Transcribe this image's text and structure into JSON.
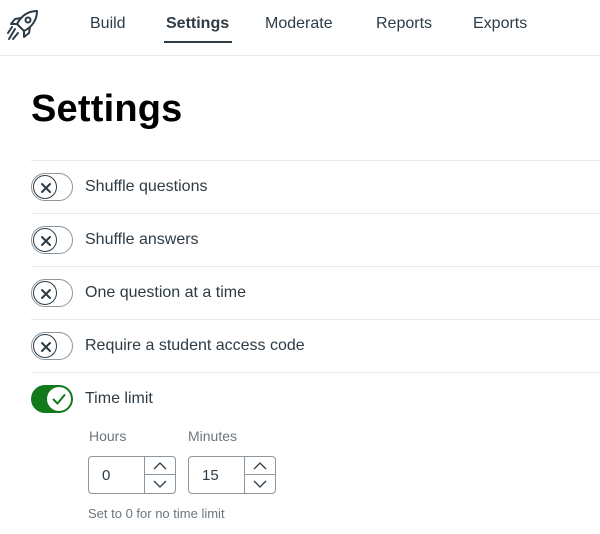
{
  "nav": {
    "logo_icon": "rocket-icon",
    "tabs": [
      {
        "label": "Build",
        "active": false
      },
      {
        "label": "Settings",
        "active": true
      },
      {
        "label": "Moderate",
        "active": false
      },
      {
        "label": "Reports",
        "active": false
      },
      {
        "label": "Exports",
        "active": false
      }
    ]
  },
  "page_title": "Settings",
  "settings": [
    {
      "label": "Shuffle questions",
      "enabled": false
    },
    {
      "label": "Shuffle answers",
      "enabled": false
    },
    {
      "label": "One question at a time",
      "enabled": false
    },
    {
      "label": "Require a student access code",
      "enabled": false
    },
    {
      "label": "Time limit",
      "enabled": true
    }
  ],
  "time_limit": {
    "hours_label": "Hours",
    "hours_value": "0",
    "minutes_label": "Minutes",
    "minutes_value": "15",
    "hint": "Set to 0 for no time limit"
  },
  "colors": {
    "accent_green": "#127a1b",
    "text": "#2d3b45",
    "muted": "#6b7780",
    "divider": "#e6e9ec"
  }
}
